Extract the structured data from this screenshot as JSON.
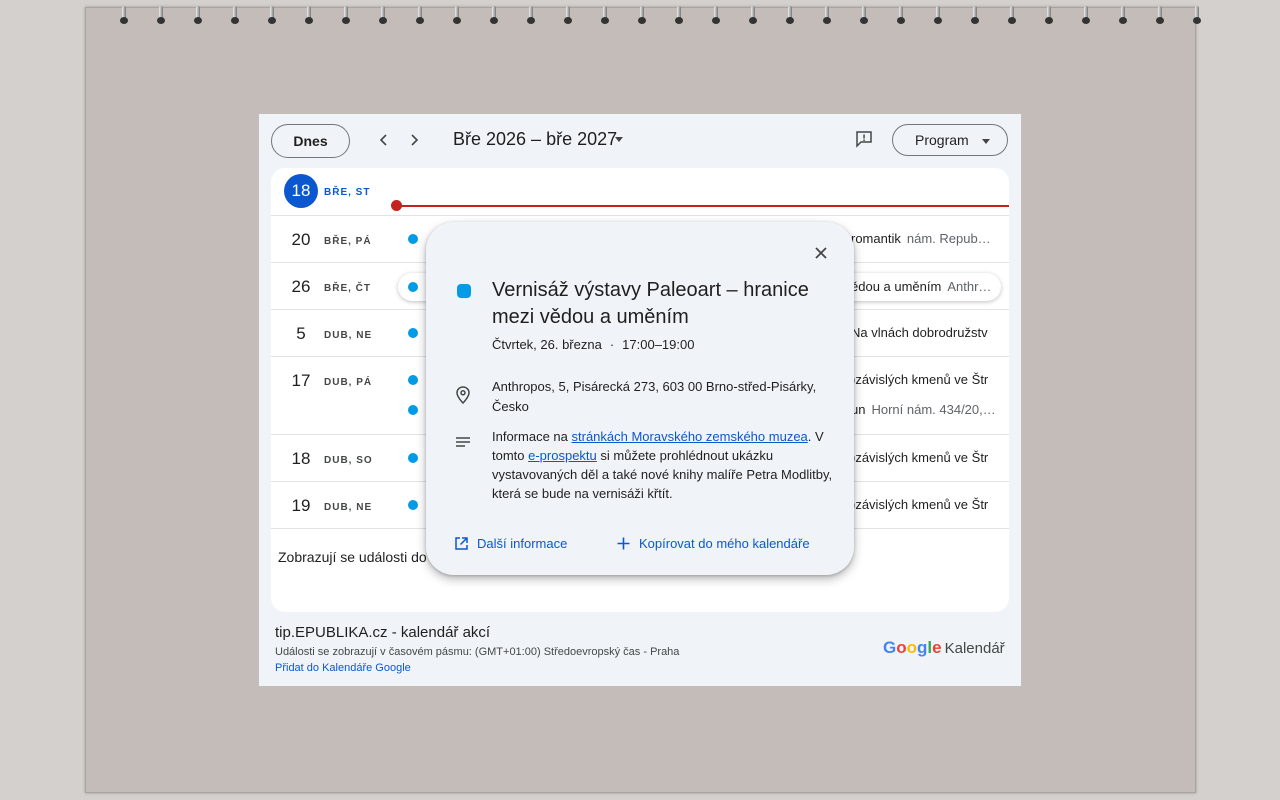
{
  "toolbar": {
    "today_label": "Dnes",
    "range_title": "Bře 2026 – bře 2027",
    "view_label": "Program"
  },
  "today": {
    "day": "18",
    "dow": "BŘE, ST"
  },
  "agenda": [
    {
      "day": "20",
      "dow": "BŘE, PÁ",
      "events": [
        {
          "title": "romantik",
          "location": "nám. Repub…"
        }
      ]
    },
    {
      "day": "26",
      "dow": "BŘE, ČT",
      "events": [
        {
          "title": "ědou a uměním",
          "location": "Anthr…"
        }
      ]
    },
    {
      "day": "5",
      "dow": "DUB, NE",
      "events": [
        {
          "title": "Na vlnách dobrodružstv",
          "location": ""
        }
      ]
    },
    {
      "day": "17",
      "dow": "DUB, PÁ",
      "events": [
        {
          "title": ")závislých kmenů ve Štr",
          "location": ""
        },
        {
          "title": "un",
          "location": "Horní nám. 434/20,…"
        }
      ]
    },
    {
      "day": "18",
      "dow": "DUB, SO",
      "events": [
        {
          "title": ")závislých kmenů ve Štr",
          "location": ""
        }
      ]
    },
    {
      "day": "19",
      "dow": "DUB, NE",
      "events": [
        {
          "title": ")závislých kmenů ve Štr",
          "location": ""
        }
      ]
    }
  ],
  "agenda_footer": "Zobrazují se události do",
  "footer": {
    "calendar_name": "tip.EPUBLIKA.cz - kalendář akcí",
    "timezone_note": "Události se zobrazují v časovém pásmu: (GMT+01:00) Středoevropský čas - Praha",
    "add_link": "Přidat do Kalendáře Google",
    "brand_google": [
      "G",
      "o",
      "o",
      "g",
      "l",
      "e"
    ],
    "brand_suffix": "Kalendář"
  },
  "popup": {
    "title": "Vernisáž výstavy Paleoart – hranice mezi vědou a uměním",
    "date": "Čtvrtek, 26. března",
    "time": "17:00–19:00",
    "location": "Anthropos, 5, Pisárecká 273, 603 00 Brno-střed-Pisárky, Česko",
    "desc_1": "Informace na ",
    "desc_link_1": "stránkách Moravského zemského muzea",
    "desc_2": ". V tomto ",
    "desc_link_2": "e-prospektu",
    "desc_3": " si můžete prohlédnout ukázku vystavovaných děl a také nové knihy malíře Petra Modlitby, která se bude na vernisáži křtít.",
    "more_info": "Další informace",
    "copy_to_calendar": "Kopírovat do mého kalendáře"
  },
  "colors": {
    "accent": "#0b57d0",
    "event": "#039be5",
    "now_line": "#c5221f",
    "board": "#c4bcb8"
  },
  "icons": [
    "chevron-left-icon",
    "chevron-right-icon",
    "dropdown-caret-icon",
    "feedback-icon",
    "close-icon",
    "location-pin-icon",
    "notes-icon",
    "open-external-icon",
    "plus-icon"
  ]
}
